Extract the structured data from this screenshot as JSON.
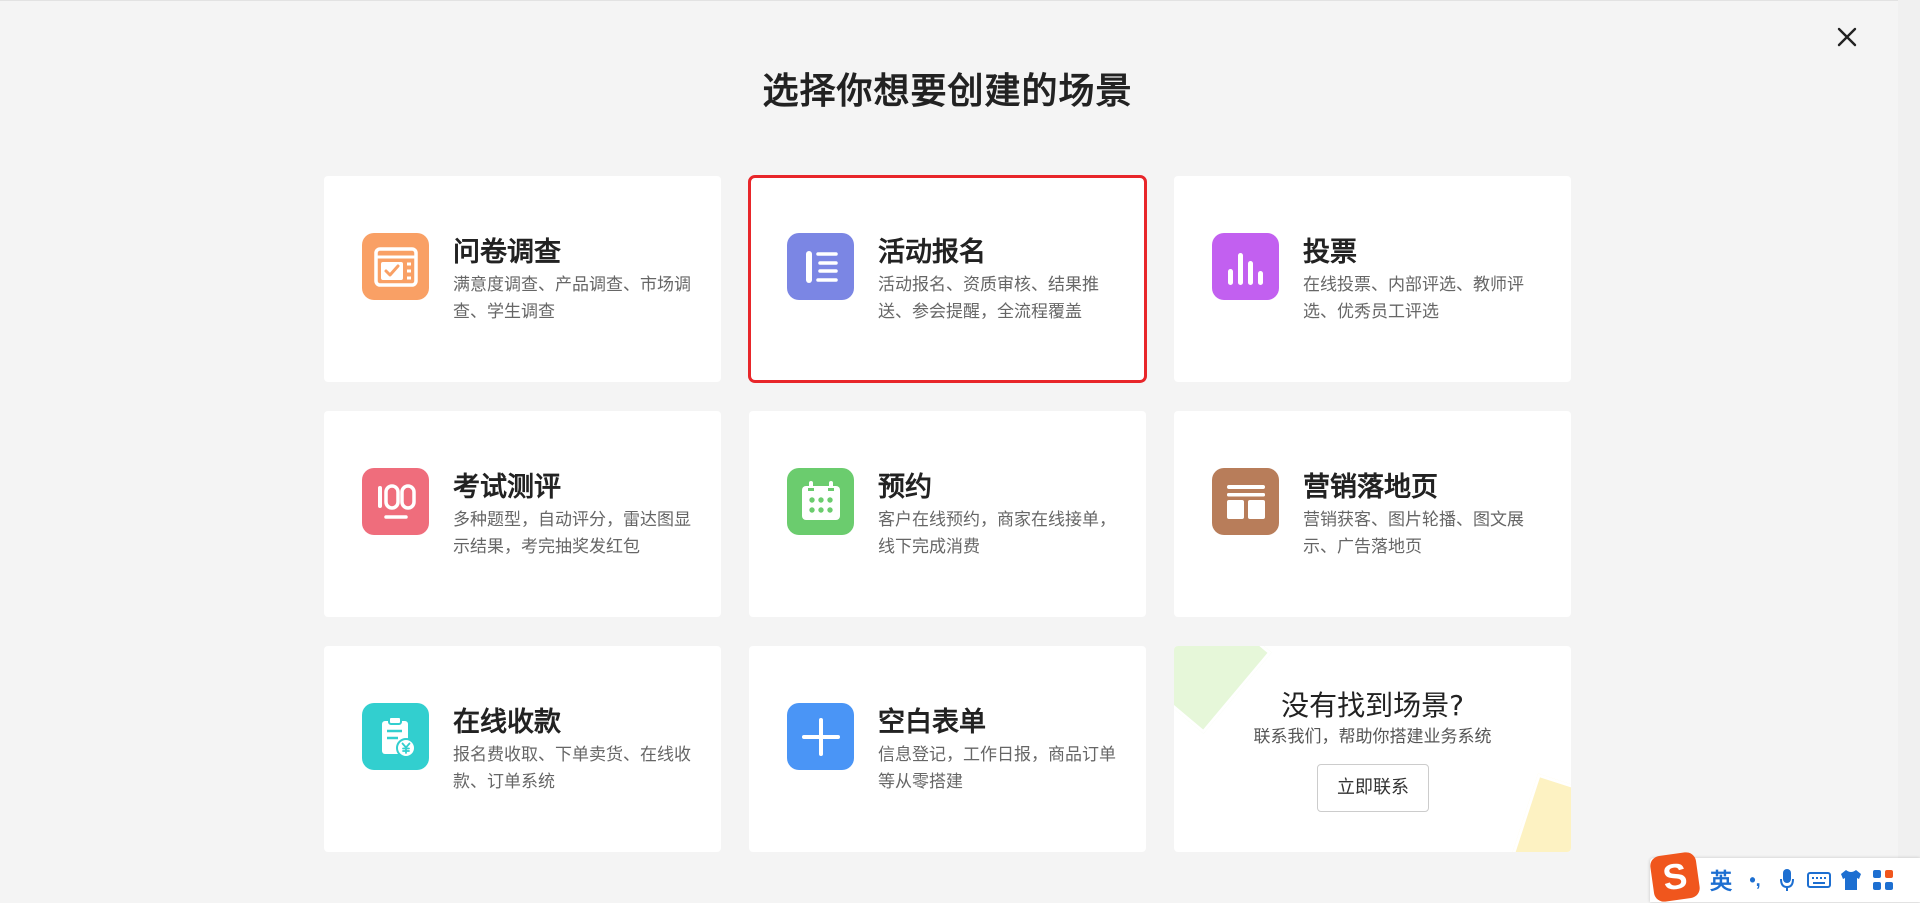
{
  "dialog": {
    "title": "选择你想要创建的场景",
    "close_icon": "close-icon"
  },
  "scenes": [
    {
      "id": "survey",
      "title": "问卷调查",
      "desc": "满意度调查、产品调查、市场调查、学生调查",
      "icon": "survey-check-icon",
      "color": "#f9a065",
      "selected": false
    },
    {
      "id": "event",
      "title": "活动报名",
      "desc": "活动报名、资质审核、结果推送、参会提醒，全流程覆盖",
      "icon": "event-list-icon",
      "color": "#7b86e4",
      "selected": true
    },
    {
      "id": "vote",
      "title": "投票",
      "desc": "在线投票、内部评选、教师评选、优秀员工评选",
      "icon": "bar-chart-icon",
      "color": "#c260f0",
      "selected": false
    },
    {
      "id": "exam",
      "title": "考试测评",
      "desc": "多种题型，自动评分，雷达图显示结果，考完抽奖发红包",
      "icon": "score-100-icon",
      "color": "#ef6d7c",
      "selected": false
    },
    {
      "id": "booking",
      "title": "预约",
      "desc": "客户在线预约，商家在线接单，线下完成消费",
      "icon": "calendar-icon",
      "color": "#6bcc6e",
      "selected": false
    },
    {
      "id": "landing",
      "title": "营销落地页",
      "desc": "营销获客、图片轮播、图文展示、广告落地页",
      "icon": "layout-page-icon",
      "color": "#b87d5a",
      "selected": false
    },
    {
      "id": "payment",
      "title": "在线收款",
      "desc": "报名费收取、下单卖货、在线收款、订单系统",
      "icon": "receipt-yen-icon",
      "color": "#32cfcf",
      "selected": false
    },
    {
      "id": "blank",
      "title": "空白表单",
      "desc": "信息登记，工作日报，商品订单等从零搭建",
      "icon": "plus-icon",
      "color": "#4a95f6",
      "selected": false
    }
  ],
  "contact": {
    "title": "没有找到场景?",
    "subtitle": "联系我们，帮助你搭建业务系统",
    "button": "立即联系"
  },
  "ime": {
    "lang": "英",
    "punct": "•,",
    "logo": "S"
  },
  "colors": {
    "selected_border": "#e8262a",
    "background": "#f4f4f4",
    "card": "#ffffff"
  }
}
